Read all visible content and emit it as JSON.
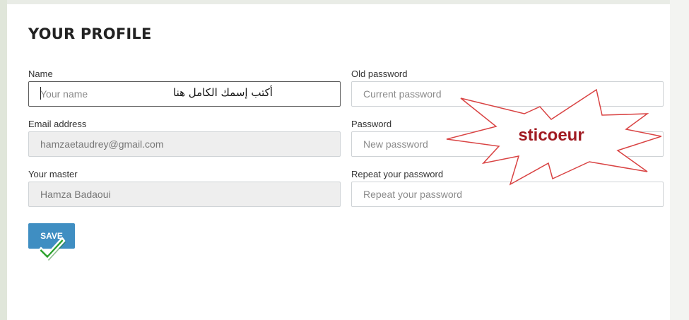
{
  "page": {
    "title": "YOUR PROFILE"
  },
  "left_column": {
    "name": {
      "label": "Name",
      "placeholder": "Your name",
      "hint": "أكتب إسمك الكامل هنا"
    },
    "email": {
      "label": "Email address",
      "value": "hamzaetaudrey@gmail.com"
    },
    "master": {
      "label": "Your master",
      "value": "Hamza Badaoui"
    }
  },
  "right_column": {
    "old_password": {
      "label": "Old password",
      "placeholder": "Current password"
    },
    "password": {
      "label": "Password",
      "placeholder": "New password"
    },
    "repeat_password": {
      "label": "Repeat your password",
      "placeholder": "Repeat your password"
    }
  },
  "actions": {
    "save_label": "SAVE"
  },
  "annotation": {
    "burst_text": "sticoeur",
    "burst_color": "#d94343",
    "check_color": "#2aa12a"
  },
  "colors": {
    "save_button": "#3f8ec2"
  }
}
